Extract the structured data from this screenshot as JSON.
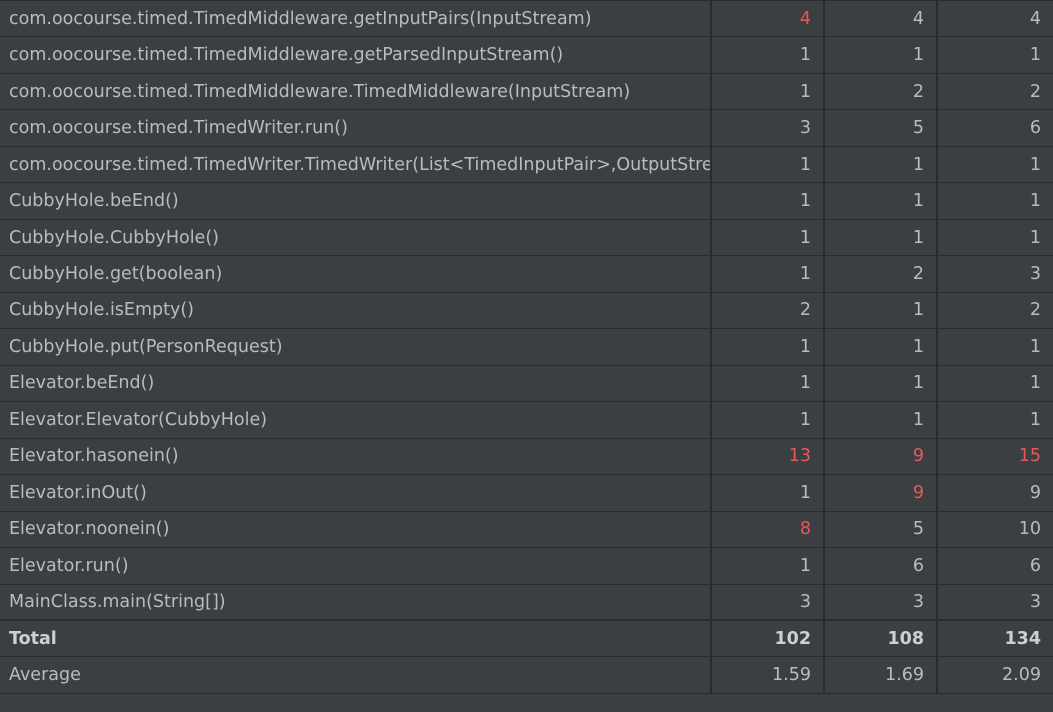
{
  "colors": {
    "background": "#3c3f41",
    "grid": "#2b2b2b",
    "text": "#bbbbbb",
    "warning": "#e8585a"
  },
  "rows": [
    {
      "method": "com.oocourse.timed.TimedMiddleware.getInputPairs(InputStream)",
      "v1": "4",
      "v2": "4",
      "v3": "4",
      "warn": [
        true,
        false,
        false
      ]
    },
    {
      "method": "com.oocourse.timed.TimedMiddleware.getParsedInputStream()",
      "v1": "1",
      "v2": "1",
      "v3": "1",
      "warn": [
        false,
        false,
        false
      ]
    },
    {
      "method": "com.oocourse.timed.TimedMiddleware.TimedMiddleware(InputStream)",
      "v1": "1",
      "v2": "2",
      "v3": "2",
      "warn": [
        false,
        false,
        false
      ]
    },
    {
      "method": "com.oocourse.timed.TimedWriter.run()",
      "v1": "3",
      "v2": "5",
      "v3": "6",
      "warn": [
        false,
        false,
        false
      ]
    },
    {
      "method": "com.oocourse.timed.TimedWriter.TimedWriter(List<TimedInputPair>,OutputStrea",
      "v1": "1",
      "v2": "1",
      "v3": "1",
      "warn": [
        false,
        false,
        false
      ]
    },
    {
      "method": "CubbyHole.beEnd()",
      "v1": "1",
      "v2": "1",
      "v3": "1",
      "warn": [
        false,
        false,
        false
      ]
    },
    {
      "method": "CubbyHole.CubbyHole()",
      "v1": "1",
      "v2": "1",
      "v3": "1",
      "warn": [
        false,
        false,
        false
      ]
    },
    {
      "method": "CubbyHole.get(boolean)",
      "v1": "1",
      "v2": "2",
      "v3": "3",
      "warn": [
        false,
        false,
        false
      ]
    },
    {
      "method": "CubbyHole.isEmpty()",
      "v1": "2",
      "v2": "1",
      "v3": "2",
      "warn": [
        false,
        false,
        false
      ]
    },
    {
      "method": "CubbyHole.put(PersonRequest)",
      "v1": "1",
      "v2": "1",
      "v3": "1",
      "warn": [
        false,
        false,
        false
      ]
    },
    {
      "method": "Elevator.beEnd()",
      "v1": "1",
      "v2": "1",
      "v3": "1",
      "warn": [
        false,
        false,
        false
      ]
    },
    {
      "method": "Elevator.Elevator(CubbyHole)",
      "v1": "1",
      "v2": "1",
      "v3": "1",
      "warn": [
        false,
        false,
        false
      ]
    },
    {
      "method": "Elevator.hasonein()",
      "v1": "13",
      "v2": "9",
      "v3": "15",
      "warn": [
        true,
        true,
        true
      ]
    },
    {
      "method": "Elevator.inOut()",
      "v1": "1",
      "v2": "9",
      "v3": "9",
      "warn": [
        false,
        true,
        false
      ]
    },
    {
      "method": "Elevator.noonein()",
      "v1": "8",
      "v2": "5",
      "v3": "10",
      "warn": [
        true,
        false,
        false
      ]
    },
    {
      "method": "Elevator.run()",
      "v1": "1",
      "v2": "6",
      "v3": "6",
      "warn": [
        false,
        false,
        false
      ]
    },
    {
      "method": "MainClass.main(String[])",
      "v1": "3",
      "v2": "3",
      "v3": "3",
      "warn": [
        false,
        false,
        false
      ]
    }
  ],
  "total": {
    "label": "Total",
    "v1": "102",
    "v2": "108",
    "v3": "134"
  },
  "average": {
    "label": "Average",
    "v1": "1.59",
    "v2": "1.69",
    "v3": "2.09"
  }
}
